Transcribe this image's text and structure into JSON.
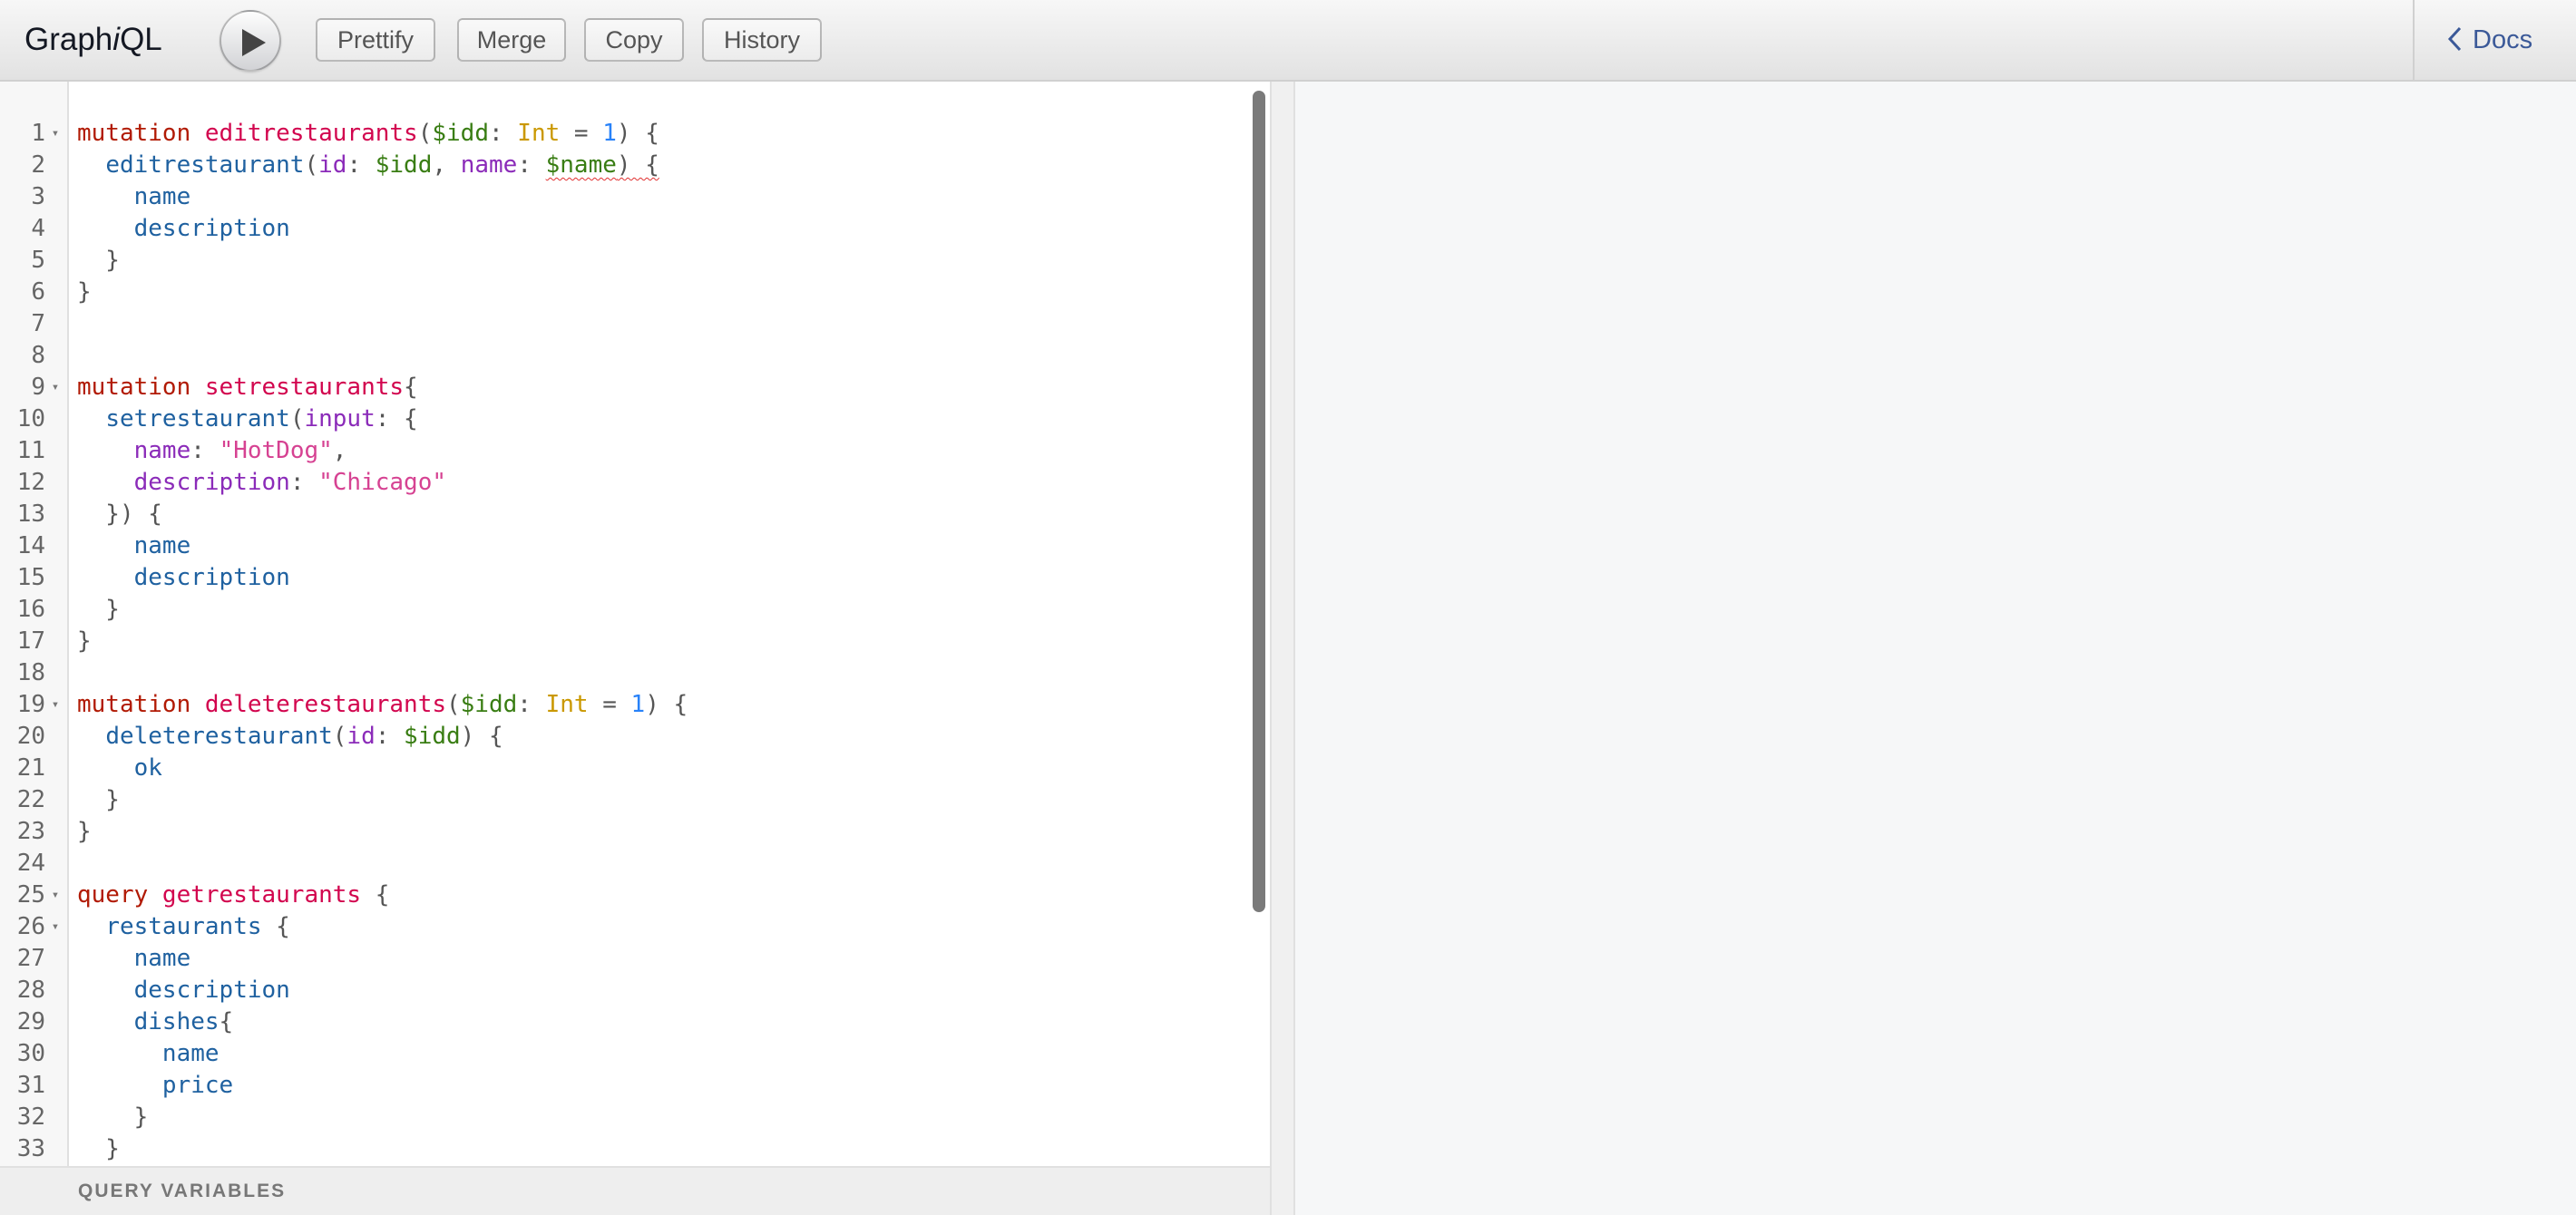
{
  "app": {
    "logo_prefix": "Graph",
    "logo_italic": "i",
    "logo_suffix": "QL"
  },
  "toolbar": {
    "prettify": "Prettify",
    "merge": "Merge",
    "copy": "Copy",
    "history": "History",
    "docs": "Docs"
  },
  "editor": {
    "lines": [
      [
        [
          "kw",
          "mutation "
        ],
        [
          "def",
          "editrestaurants"
        ],
        [
          "pun",
          "("
        ],
        [
          "var",
          "$idd"
        ],
        [
          "pun",
          ": "
        ],
        [
          "type",
          "Int"
        ],
        [
          "pun",
          " = "
        ],
        [
          "num",
          "1"
        ],
        [
          "pun",
          ") {"
        ]
      ],
      [
        [
          "pun",
          "  "
        ],
        [
          "prop",
          "editrestaurant"
        ],
        [
          "pun",
          "("
        ],
        [
          "attr",
          "id"
        ],
        [
          "pun",
          ": "
        ],
        [
          "var",
          "$idd"
        ],
        [
          "pun",
          ", "
        ],
        [
          "attr",
          "name"
        ],
        [
          "pun",
          ": "
        ],
        [
          "var squiggle",
          "$name"
        ],
        [
          "pun squiggle",
          ") {"
        ]
      ],
      [
        [
          "pun",
          "    "
        ],
        [
          "prop",
          "name"
        ]
      ],
      [
        [
          "pun",
          "    "
        ],
        [
          "prop",
          "description"
        ]
      ],
      [
        [
          "pun",
          "  }"
        ]
      ],
      [
        [
          "pun",
          "}"
        ]
      ],
      [],
      [],
      [
        [
          "kw",
          "mutation "
        ],
        [
          "def",
          "setrestaurants"
        ],
        [
          "pun",
          "{"
        ]
      ],
      [
        [
          "pun",
          "  "
        ],
        [
          "prop",
          "setrestaurant"
        ],
        [
          "pun",
          "("
        ],
        [
          "attr",
          "input"
        ],
        [
          "pun",
          ": {"
        ]
      ],
      [
        [
          "pun",
          "    "
        ],
        [
          "attr",
          "name"
        ],
        [
          "pun",
          ": "
        ],
        [
          "str",
          "\"HotDog\""
        ],
        [
          "pun",
          ","
        ]
      ],
      [
        [
          "pun",
          "    "
        ],
        [
          "attr",
          "description"
        ],
        [
          "pun",
          ": "
        ],
        [
          "str",
          "\"Chicago\""
        ]
      ],
      [
        [
          "pun",
          "  }) {"
        ]
      ],
      [
        [
          "pun",
          "    "
        ],
        [
          "prop",
          "name"
        ]
      ],
      [
        [
          "pun",
          "    "
        ],
        [
          "prop",
          "description"
        ]
      ],
      [
        [
          "pun",
          "  }"
        ]
      ],
      [
        [
          "pun",
          "}"
        ]
      ],
      [],
      [
        [
          "kw",
          "mutation "
        ],
        [
          "def",
          "deleterestaurants"
        ],
        [
          "pun",
          "("
        ],
        [
          "var",
          "$idd"
        ],
        [
          "pun",
          ": "
        ],
        [
          "type",
          "Int"
        ],
        [
          "pun",
          " = "
        ],
        [
          "num",
          "1"
        ],
        [
          "pun",
          ") {"
        ]
      ],
      [
        [
          "pun",
          "  "
        ],
        [
          "prop",
          "deleterestaurant"
        ],
        [
          "pun",
          "("
        ],
        [
          "attr",
          "id"
        ],
        [
          "pun",
          ": "
        ],
        [
          "var",
          "$idd"
        ],
        [
          "pun",
          ") {"
        ]
      ],
      [
        [
          "pun",
          "    "
        ],
        [
          "prop",
          "ok"
        ]
      ],
      [
        [
          "pun",
          "  }"
        ]
      ],
      [
        [
          "pun",
          "}"
        ]
      ],
      [],
      [
        [
          "kw",
          "query "
        ],
        [
          "def",
          "getrestaurants"
        ],
        [
          "pun",
          " {"
        ]
      ],
      [
        [
          "pun",
          "  "
        ],
        [
          "prop",
          "restaurants"
        ],
        [
          "pun",
          " {"
        ]
      ],
      [
        [
          "pun",
          "    "
        ],
        [
          "prop",
          "name"
        ]
      ],
      [
        [
          "pun",
          "    "
        ],
        [
          "prop",
          "description"
        ]
      ],
      [
        [
          "pun",
          "    "
        ],
        [
          "prop",
          "dishes"
        ],
        [
          "pun",
          "{"
        ]
      ],
      [
        [
          "pun",
          "      "
        ],
        [
          "prop",
          "name"
        ]
      ],
      [
        [
          "pun",
          "      "
        ],
        [
          "prop",
          "price"
        ]
      ],
      [
        [
          "pun",
          "    }"
        ]
      ],
      [
        [
          "pun",
          "  }"
        ]
      ]
    ],
    "fold_lines": [
      1,
      9,
      19,
      25,
      26
    ],
    "fold_glyph": "▾"
  },
  "variables": {
    "title": "QUERY VARIABLES"
  }
}
